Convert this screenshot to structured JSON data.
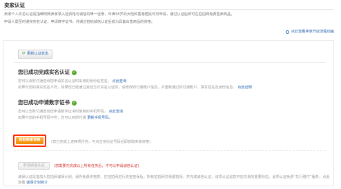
{
  "page": {
    "title": "卖家认证",
    "intro_line1": "卖家个人实名认证是指细阿网卖家录入验资格与诚信的唯一证明，年满18岁的大陆和香港居民均可申请，通过认证后即可在拍拍网免费售卖商品。",
    "intro_line2": "申请人需至时通完实名认证，申请数字证书，并通过拍拍诚信认证后成为具备出售商品的资格。",
    "topright_link": "点此查看卖家开店流程动画"
  },
  "refresh_button": {
    "label": "更新认证状态"
  },
  "realname": {
    "heading": "您已成功完成实名认证",
    "line1": "您可以去财付通查询您申请实名认证时采用的身份证姓名。",
    "line1_link": "点此查询",
    "line2": "如果与您的真实姓名不符，如果您已经通过其他方式实名认证的，请修改财付通账户信息，并重新通过财付通账户，填写姓名及身份信息。",
    "line2_link": "点此证明"
  },
  "cert": {
    "heading": "您已成功申请数字证书",
    "line1": "您可以去财付通查询您申请数字证书时使用的手机号码。",
    "line1_link": "点此查询",
    "line2_prefix": "如果与您的手机号码不符，您可以到财付通",
    "line2_link": "更新手机号码。"
  },
  "seller_button": {
    "label": "获取卖家资格"
  },
  "seller_note": "(您已完成上述两项任务，可点击身份证号码后即获取卖家资格)",
  "honest_button": {
    "label": "申请诚信认证"
  },
  "honest_note": "(您需要先完成以上所有任务后，才可以申请诚信认证)",
  "bottom": {
    "text": "诚保认证是指加入拍拍网诚保计划，保存免费资格类，在拍拍网进行资金担保后，所有拍拍网交易都担保，并完成诚信认证，该项认证是您开店交易的重要标志。此项认证免费“先行赔付”服务，点此查看",
    "link": "诚保计划简介"
  }
}
